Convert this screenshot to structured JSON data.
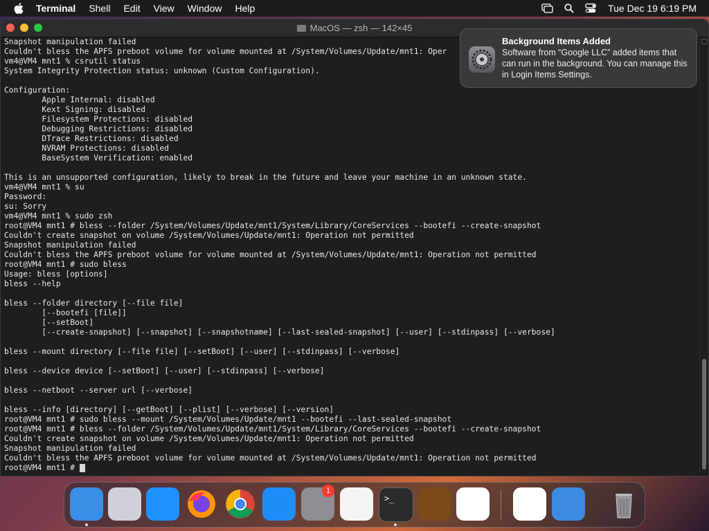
{
  "menubar": {
    "app_name": "Terminal",
    "menus": [
      "Shell",
      "Edit",
      "View",
      "Window",
      "Help"
    ],
    "clock": "Tue Dec 19  6:19 PM"
  },
  "window": {
    "title": "MacOS — zsh — 142×45"
  },
  "terminal": {
    "lines": [
      "Snapshot manipulation failed",
      "Couldn't bless the APFS preboot volume for volume mounted at /System/Volumes/Update/mnt1: Oper",
      "vm4@VM4 mnt1 % csrutil status",
      "System Integrity Protection status: unknown (Custom Configuration).",
      "",
      "Configuration:",
      "        Apple Internal: disabled",
      "        Kext Signing: disabled",
      "        Filesystem Protections: disabled",
      "        Debugging Restrictions: disabled",
      "        DTrace Restrictions: disabled",
      "        NVRAM Protections: disabled",
      "        BaseSystem Verification: enabled",
      "",
      "This is an unsupported configuration, likely to break in the future and leave your machine in an unknown state.",
      "vm4@VM4 mnt1 % su",
      "Password:",
      "su: Sorry",
      "vm4@VM4 mnt1 % sudo zsh",
      "root@VM4 mnt1 # bless --folder /System/Volumes/Update/mnt1/System/Library/CoreServices --bootefi --create-snapshot",
      "Couldn't create snapshot on volume /System/Volumes/Update/mnt1: Operation not permitted",
      "Snapshot manipulation failed",
      "Couldn't bless the APFS preboot volume for volume mounted at /System/Volumes/Update/mnt1: Operation not permitted",
      "root@VM4 mnt1 # sudo bless",
      "Usage: bless [options]",
      "bless --help",
      "",
      "bless --folder directory [--file file]",
      "        [--bootefi [file]]",
      "        [--setBoot]",
      "        [--create-snapshot] [--snapshot] [--snapshotname] [--last-sealed-snapshot] [--user] [--stdinpass] [--verbose]",
      "",
      "bless --mount directory [--file file] [--setBoot] [--user] [--stdinpass] [--verbose]",
      "",
      "bless --device device [--setBoot] [--user] [--stdinpass] [--verbose]",
      "",
      "bless --netboot --server url [--verbose]",
      "",
      "bless --info [directory] [--getBoot] [--plist] [--verbose] [--version]",
      "root@VM4 mnt1 # sudo bless --mount /System/Volumes/Update/mnt1 --bootefi --last-sealed-snapshot",
      "root@VM4 mnt1 # bless --folder /System/Volumes/Update/mnt1/System/Library/CoreServices --bootefi --create-snapshot",
      "Couldn't create snapshot on volume /System/Volumes/Update/mnt1: Operation not permitted",
      "Snapshot manipulation failed",
      "Couldn't bless the APFS preboot volume for volume mounted at /System/Volumes/Update/mnt1: Operation not permitted"
    ],
    "prompt": "root@VM4 mnt1 # "
  },
  "notification": {
    "icon": "system-settings-icon",
    "title": "Background Items Added",
    "body": "Software from “Google LLC” added items that can run in the background. You can manage this in Login Items Settings."
  },
  "dock": {
    "items": [
      {
        "name": "finder-icon",
        "color": "#3a8ee6",
        "running": true
      },
      {
        "name": "launchpad-icon",
        "color": "#d0d0d8",
        "running": false
      },
      {
        "name": "safari-icon",
        "color": "#1e90ff",
        "running": false
      },
      {
        "name": "firefox-icon",
        "color": "#ff7a1a",
        "running": false
      },
      {
        "name": "chrome-icon",
        "color": "#e8e8e8",
        "running": false
      },
      {
        "name": "app-store-icon",
        "color": "#1f8cf7",
        "running": false
      },
      {
        "name": "system-settings-icon",
        "color": "#8e8e93",
        "running": false,
        "badge": "1"
      },
      {
        "name": "textedit-icon",
        "color": "#f4f4f4",
        "running": false
      },
      {
        "name": "terminal-icon",
        "color": "#2b2b2b",
        "running": true
      },
      {
        "name": "garageband-icon",
        "color": "#7a4a1a",
        "running": false
      },
      {
        "name": "vscode-icon",
        "color": "#ffffff",
        "running": false
      },
      {
        "name": "visual-studio-icon",
        "color": "#ffffff",
        "running": false
      },
      {
        "name": "weather-icon",
        "color": "#3d8be0",
        "running": false
      },
      {
        "name": "trash-icon",
        "color": "#9a9a9e",
        "running": false
      }
    ]
  }
}
